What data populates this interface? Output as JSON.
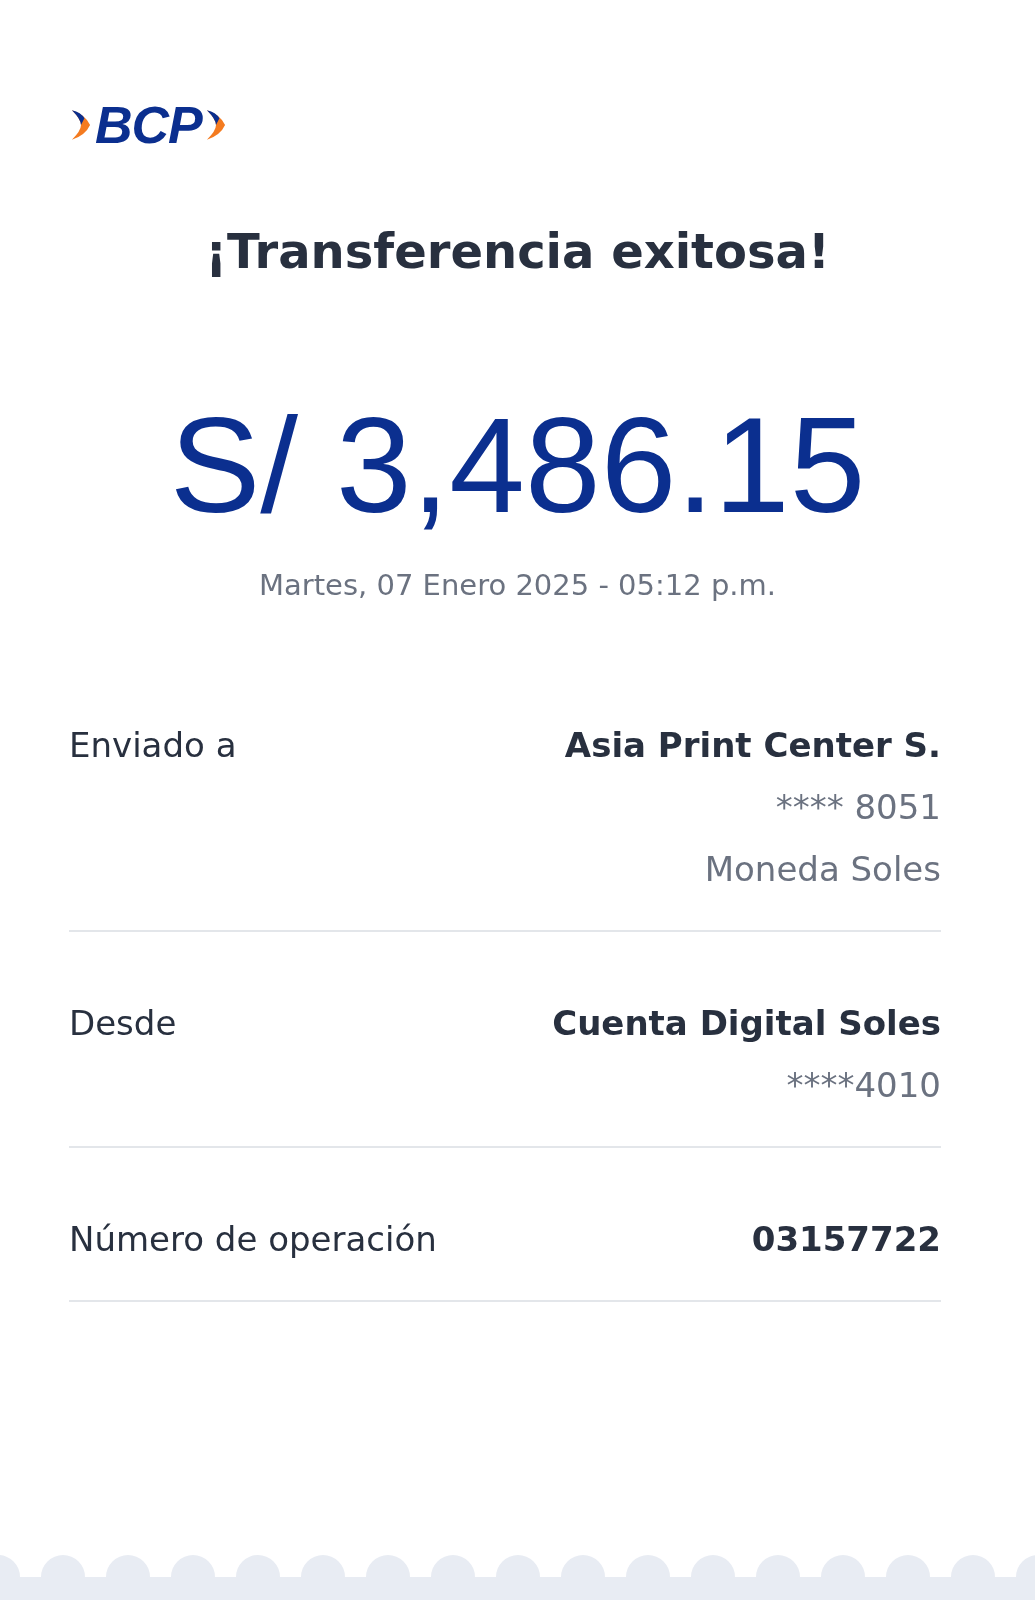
{
  "logo": {
    "text": "BCP"
  },
  "title": "¡Transferencia exitosa!",
  "amount": "S/ 3,486.15",
  "datetime": "Martes, 07 Enero 2025 - 05:12 p.m.",
  "details": [
    {
      "label": "Enviado a",
      "values": [
        "Asia Print Center S.",
        "**** 8051",
        "Moneda Soles"
      ]
    },
    {
      "label": "Desde",
      "values": [
        "Cuenta Digital Soles",
        "****4010"
      ]
    },
    {
      "label": "Número de operación",
      "values": [
        "03157722"
      ]
    }
  ]
}
